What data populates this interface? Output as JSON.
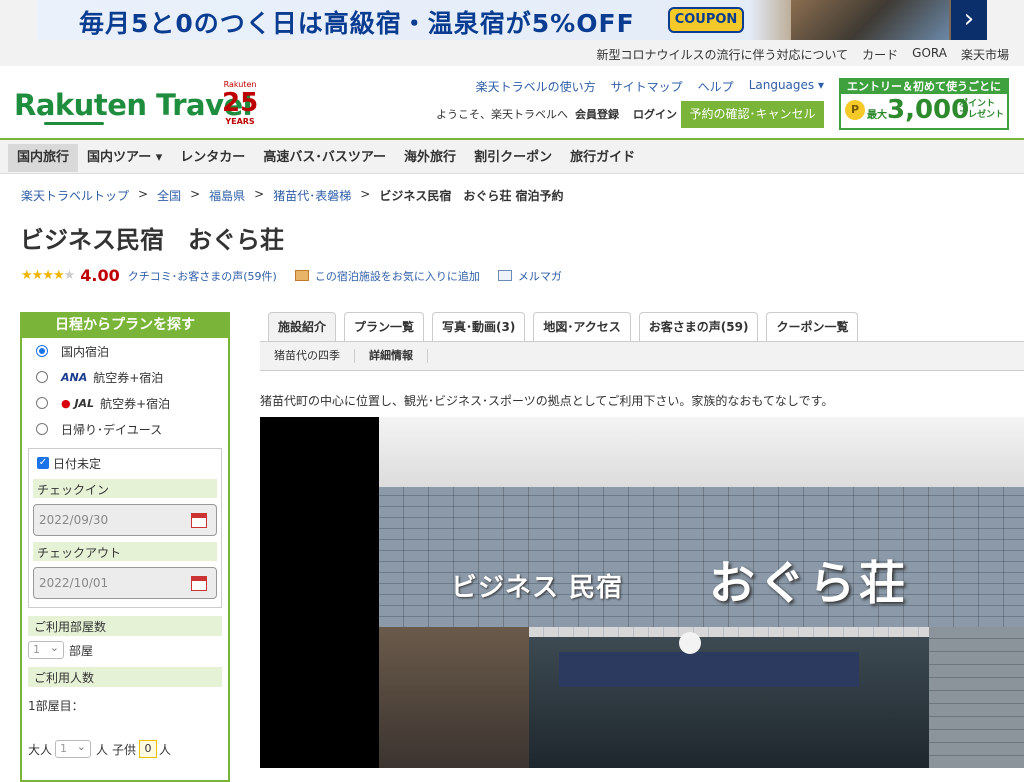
{
  "banner": {
    "text": "毎月5と0のつく日は高級宿・温泉宿が5%OFF",
    "coupon": "COUPON",
    "next": "›"
  },
  "util_links": [
    "新型コロナウイルスの流行に伴う対応について",
    "カード",
    "GORA",
    "楽天市場"
  ],
  "header": {
    "logo": "Rakuten Travel",
    "badge_small": "Rakuten",
    "badge_number": "25",
    "badge_years": "YEARS",
    "links": [
      "楽天トラベルの使い方",
      "サイトマップ",
      "ヘルプ",
      "Languages ▾"
    ],
    "welcome": "ようこそ、楽天トラベルへ",
    "register": "会員登録",
    "login": "ログイン",
    "reserve_button": "予約の確認･キャンセル",
    "entry_top": "エントリー＆初めて使うごとに",
    "entry_coin": "P",
    "entry_pre": "最大",
    "entry_amount": "3,000",
    "entry_post": "ポイント プレゼント"
  },
  "nav": [
    "国内旅行",
    "国内ツアー ▾",
    "レンタカー",
    "高速バス･バスツアー",
    "海外旅行",
    "割引クーポン",
    "旅行ガイド"
  ],
  "breadcrumb": {
    "items": [
      "楽天トラベルトップ",
      "全国",
      "福島県",
      "猪苗代･表磐梯"
    ],
    "current": "ビジネス民宿　おぐら荘 宿泊予約",
    "sep": ">"
  },
  "hotel": {
    "name": "ビジネス民宿　おぐら荘",
    "stars_filled": "★★★★",
    "stars_empty": "★",
    "score": "4.00",
    "reviews": "クチコミ･お客さまの声(59件)",
    "favorite": "この宿泊施設をお気に入りに追加",
    "mail": "メルマガ"
  },
  "sidebar": {
    "title": "日程からプランを探す",
    "options": [
      "国内宿泊",
      "航空券+宿泊",
      "航空券+宿泊",
      "日帰り･デイユース"
    ],
    "ana_logo": "ANA",
    "jal_logo": "JAL",
    "undecided": "日付未定",
    "checkin_label": "チェックイン",
    "checkin_value": "2022/09/30",
    "checkout_label": "チェックアウト",
    "checkout_value": "2022/10/01",
    "rooms_label": "ご利用部屋数",
    "rooms_value": "1",
    "rooms_unit": "部屋",
    "people_label": "ご利用人数",
    "room1_label": "1部屋目：",
    "adult_label": "大人",
    "adult_value": "1",
    "adult_unit": "人",
    "child_label": "子供",
    "child_value": "0",
    "child_unit": "人"
  },
  "tabs": [
    "施設紹介",
    "プラン一覧",
    "写真･動画(3)",
    "地図･アクセス",
    "お客さまの声(59)",
    "クーポン一覧"
  ],
  "subtabs": [
    "猪苗代の四季",
    "詳細情報"
  ],
  "description": "猪苗代町の中心に位置し、観光･ビジネス･スポーツの拠点としてご利用下さい。家族的なおもてなしです。",
  "photo": {
    "sign_small": "ビジネス 民宿",
    "sign_large": "おぐら荘"
  }
}
